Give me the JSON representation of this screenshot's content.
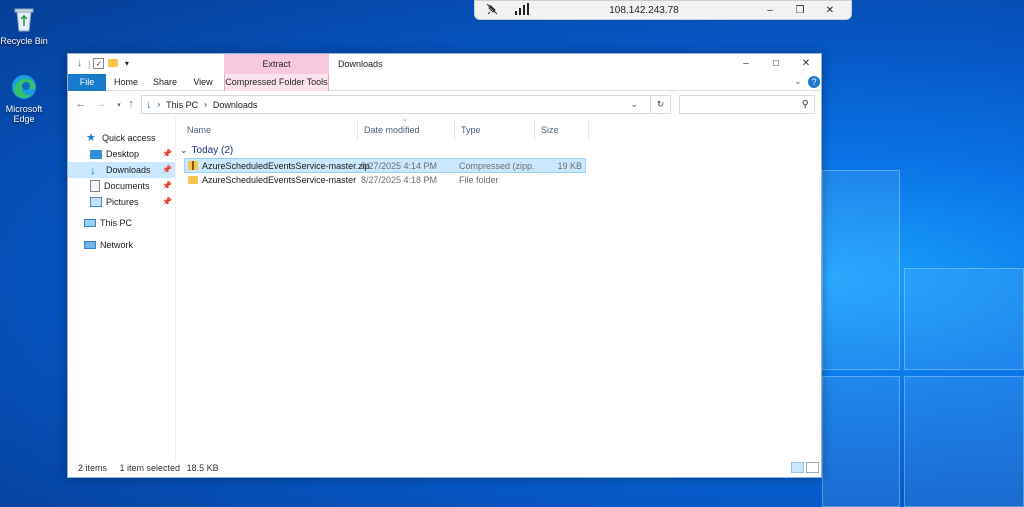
{
  "desktop": {
    "icons": [
      {
        "label": "Recycle Bin"
      },
      {
        "label": "Microsoft Edge"
      }
    ]
  },
  "rdp_bar": {
    "title": "108.142.243.78"
  },
  "window": {
    "title": "Downloads",
    "contextual_tab_group": "Extract",
    "ribbon_tabs": [
      "File",
      "Home",
      "Share",
      "View",
      "Compressed Folder Tools"
    ],
    "address": {
      "crumbs": [
        "This PC",
        "Downloads"
      ]
    },
    "search": {
      "placeholder": ""
    },
    "nav": {
      "items": [
        {
          "label": "Quick access",
          "pinned": false
        },
        {
          "label": "Desktop",
          "pinned": true
        },
        {
          "label": "Downloads",
          "pinned": true,
          "selected": true
        },
        {
          "label": "Documents",
          "pinned": true
        },
        {
          "label": "Pictures",
          "pinned": true
        },
        {
          "label": "This PC",
          "pinned": false
        },
        {
          "label": "Network",
          "pinned": false
        }
      ]
    },
    "columns": [
      "Name",
      "Date modified",
      "Type",
      "Size"
    ],
    "group_label": "Today (2)",
    "files": [
      {
        "name": "AzureScheduledEventsService-master.zip",
        "date": "8/27/2025 4:14 PM",
        "type": "Compressed (zipp...",
        "size": "19 KB",
        "selected": true
      },
      {
        "name": "AzureScheduledEventsService-master",
        "date": "8/27/2025 4:18 PM",
        "type": "File folder",
        "size": ""
      }
    ],
    "status": {
      "count": "2 items",
      "selection": "1 item selected",
      "size": "18.5 KB"
    }
  }
}
